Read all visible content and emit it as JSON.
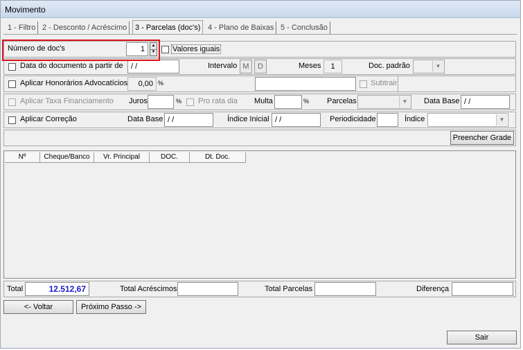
{
  "window": {
    "title": "Movimento"
  },
  "tabs": [
    {
      "label": "1 - Filtro"
    },
    {
      "label": "2 - Desconto / Acréscimo"
    },
    {
      "label": "3 - Parcelas (doc's)"
    },
    {
      "label": "4 - Plano de Baixas"
    },
    {
      "label": "5 - Conclusão"
    }
  ],
  "row1": {
    "num_docs_label": "Número de doc's",
    "num_docs_value": "1",
    "valores_iguais_label": "Valores iguais"
  },
  "row2": {
    "data_doc_label": "Data do documento a partir de",
    "data_doc_value": "/ /",
    "intervalo_label": "Intervalo",
    "btn_m": "M",
    "btn_d": "D",
    "meses_label": "Meses",
    "meses_value": "1",
    "doc_padrao_label": "Doc. padrão"
  },
  "row3": {
    "honorarios_label": "Aplicar Honorários Advocatícios",
    "honorarios_value": "0,00",
    "percent": "%",
    "subtrair_label": "Subtrair"
  },
  "row4": {
    "taxa_label": "Aplicar Taxa Financiamento",
    "juros_label": "Juros",
    "percent": "%",
    "pro_rata_label": "Pro rata dia",
    "multa_label": "Multa",
    "parcelas_label": "Parcelas",
    "data_base_label": "Data Base",
    "data_base_value": "/ /"
  },
  "row5": {
    "correcao_label": "Aplicar Correção",
    "data_base_label": "Data Base",
    "data_base_value": "/ /",
    "indice_inicial_label": "Índice Inicial",
    "indice_inicial_value": "/ /",
    "periodicidade_label": "Periodicidade",
    "indice_label": "Índice"
  },
  "preencher_grade": "Preencher Grade",
  "grid": {
    "columns": [
      "Nº",
      "Cheque/Banco",
      "Vr. Principal",
      "DOC.",
      "Dt. Doc."
    ]
  },
  "totals": {
    "total_label": "Total",
    "total_value": "12.512,67",
    "acrescimos_label": "Total Acréscimos",
    "parcelas_label": "Total Parcelas",
    "diferenca_label": "Diferença"
  },
  "nav": {
    "voltar": "<- Voltar",
    "proximo": "Próximo Passo ->"
  },
  "sair": "Sair",
  "colors": {
    "highlight": "#d9141b",
    "total_value": "#1a1ad0"
  }
}
